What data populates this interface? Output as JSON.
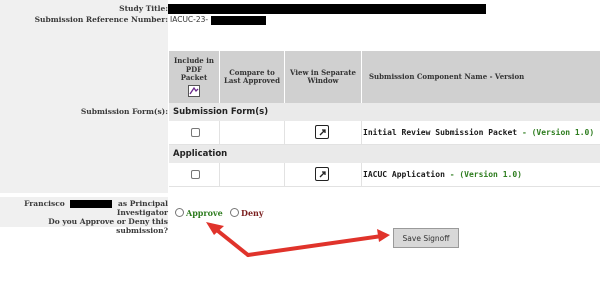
{
  "fields": {
    "study_title_label": "Study Title:",
    "submission_ref_label": "Submission Reference Number:",
    "submission_ref_value": "IACUC-23-",
    "submission_forms_label": "Submission Form(s):"
  },
  "table": {
    "headers": {
      "include_pdf": "Include in PDF Packet",
      "compare": "Compare to Last Approved",
      "view_window": "View in Separate Window",
      "component_name": "Submission Component Name - Version"
    },
    "sections": [
      {
        "title": "Submission Form(s)",
        "rows": [
          {
            "name": "Initial Review Submission Packet",
            "separator": " - ",
            "version": "(Version 1.0)"
          }
        ]
      },
      {
        "title": "Application",
        "rows": [
          {
            "name": "IACUC Application",
            "separator": " - ",
            "version": "(Version 1.0)"
          }
        ]
      }
    ]
  },
  "signoff": {
    "name_prefix": "Francisco",
    "role_text": "as Principal",
    "role_text2": "Investigator",
    "question": "Do you Approve or Deny this submission?",
    "approve_label": "Approve",
    "deny_label": "Deny",
    "save_button": "Save Signoff"
  },
  "colors": {
    "approve": "#2e7d1f",
    "deny": "#7a1e1e",
    "arrow": "#e0332b",
    "version": "#2e7d1f"
  },
  "icons": {
    "pdf_header": "pdf-packet-icon",
    "view_window": "external-window-icon"
  }
}
